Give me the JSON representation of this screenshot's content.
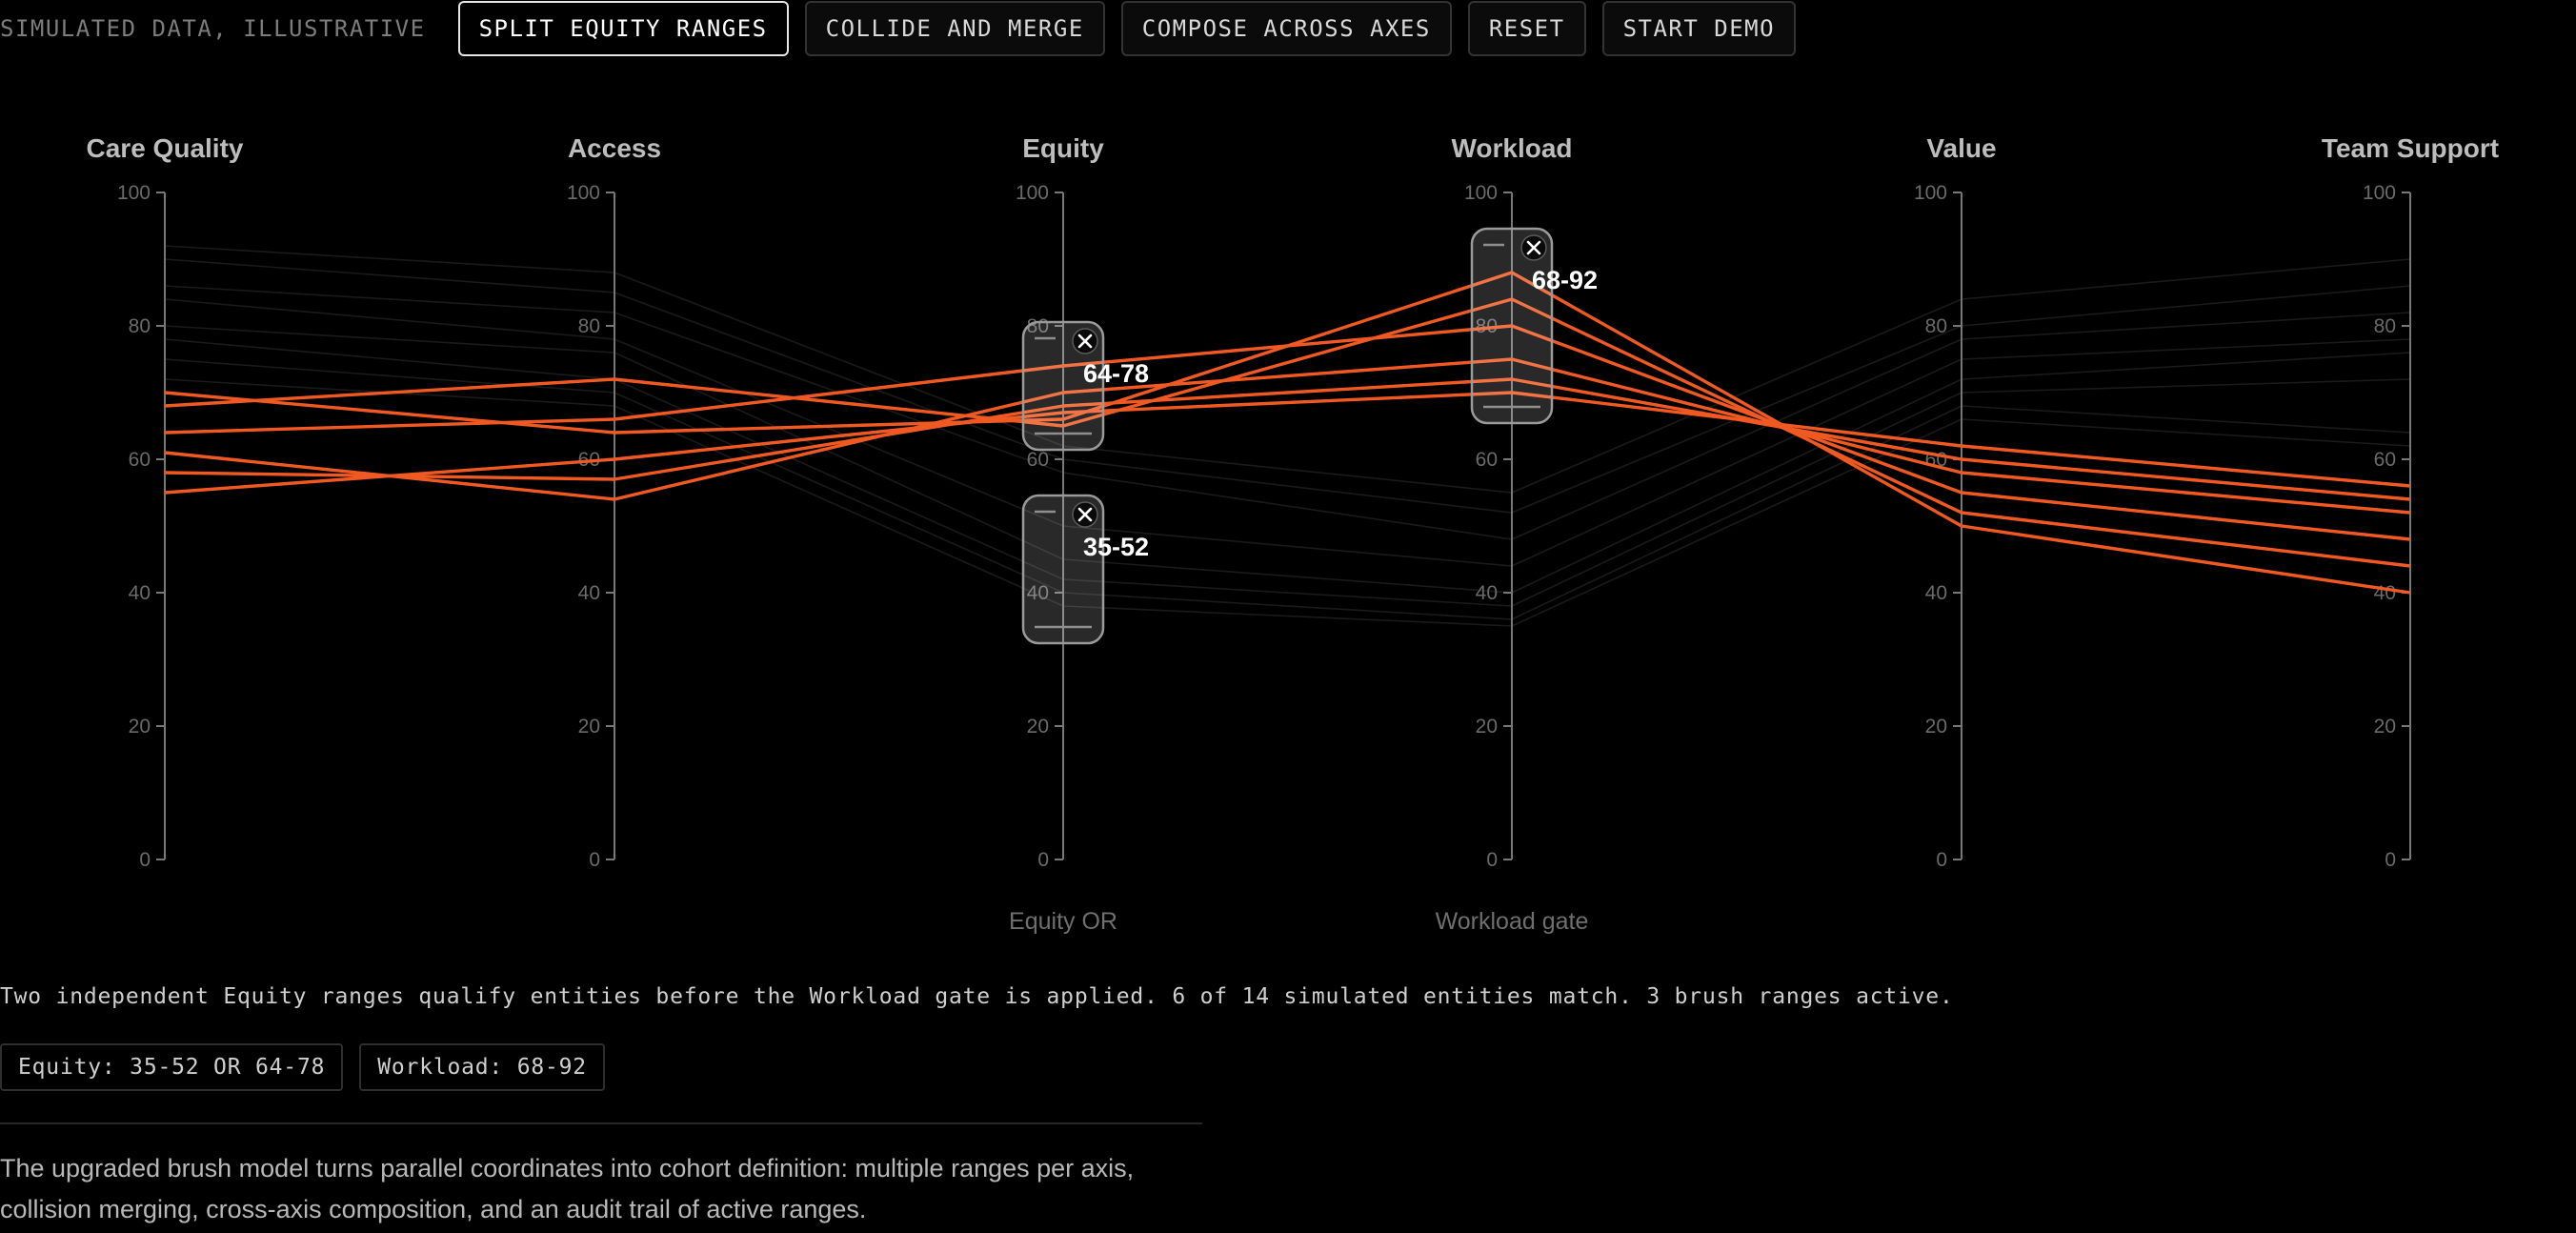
{
  "toolbar": {
    "label": "SIMULATED DATA, ILLUSTRATIVE",
    "buttons": {
      "split": "SPLIT EQUITY RANGES",
      "collide": "COLLIDE AND MERGE",
      "compose": "COMPOSE ACROSS AXES",
      "reset": "RESET",
      "demo": "START DEMO"
    },
    "active": "split"
  },
  "colors": {
    "highlight": "#f05a22",
    "dim": "#3a3a3a",
    "axis": "#777777",
    "brush_border": "#9a9a9a"
  },
  "chart_data": {
    "type": "parallel-coordinates",
    "axes": [
      {
        "name": "Care Quality",
        "caption": ""
      },
      {
        "name": "Access",
        "caption": ""
      },
      {
        "name": "Equity",
        "caption": "Equity OR"
      },
      {
        "name": "Workload",
        "caption": "Workload gate"
      },
      {
        "name": "Value",
        "caption": ""
      },
      {
        "name": "Team Support",
        "caption": ""
      }
    ],
    "ylim": [
      0,
      100
    ],
    "ticks": [
      0,
      20,
      40,
      60,
      80,
      100
    ],
    "brushes": [
      {
        "axis": 2,
        "range": [
          64,
          78
        ],
        "label": "64-78"
      },
      {
        "axis": 2,
        "range": [
          35,
          52
        ],
        "label": "35-52"
      },
      {
        "axis": 3,
        "range": [
          68,
          92
        ],
        "label": "68-92"
      }
    ],
    "entities": [
      {
        "values": [
          70,
          64,
          66,
          88,
          50,
          40
        ],
        "match": true
      },
      {
        "values": [
          68,
          72,
          65,
          84,
          52,
          44
        ],
        "match": true
      },
      {
        "values": [
          64,
          66,
          74,
          80,
          55,
          48
        ],
        "match": true
      },
      {
        "values": [
          61,
          54,
          70,
          75,
          58,
          52
        ],
        "match": true
      },
      {
        "values": [
          58,
          57,
          68,
          72,
          60,
          54
        ],
        "match": true
      },
      {
        "values": [
          55,
          60,
          67,
          70,
          62,
          56
        ],
        "match": true
      },
      {
        "values": [
          92,
          88,
          62,
          55,
          84,
          90
        ],
        "match": false
      },
      {
        "values": [
          90,
          85,
          60,
          52,
          80,
          86
        ],
        "match": false
      },
      {
        "values": [
          86,
          82,
          58,
          48,
          78,
          82
        ],
        "match": false
      },
      {
        "values": [
          84,
          78,
          50,
          44,
          75,
          78
        ],
        "match": false
      },
      {
        "values": [
          80,
          76,
          45,
          40,
          72,
          76
        ],
        "match": false
      },
      {
        "values": [
          78,
          72,
          42,
          38,
          70,
          72
        ],
        "match": false
      },
      {
        "values": [
          75,
          70,
          40,
          36,
          68,
          64
        ],
        "match": false
      },
      {
        "values": [
          72,
          68,
          38,
          35,
          66,
          62
        ],
        "match": false
      }
    ]
  },
  "summary": "Two independent Equity ranges qualify entities before the Workload gate is applied. 6 of 14 simulated entities match. 3 brush ranges active.",
  "pills": {
    "equity": "Equity: 35-52 OR 64-78",
    "workload": "Workload: 68-92"
  },
  "description": "The upgraded brush model turns parallel coordinates into cohort definition: multiple ranges per axis, collision merging, cross-axis composition, and an audit trail of active ranges."
}
